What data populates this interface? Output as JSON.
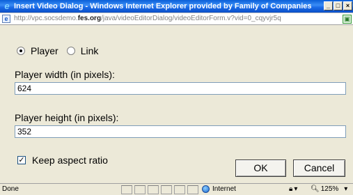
{
  "window": {
    "title": "Insert Video Dialog - Windows Internet Explorer provided by Family of Companies",
    "buttons": {
      "minimize": "_",
      "maximize": "□",
      "close": "×"
    }
  },
  "address": {
    "url_prefix": "http://vpc.socsdemo.",
    "url_domain": "fes.org",
    "url_suffix": "/java/videoEditorDialog/videoEditorForm.v?vid=0_cqyvjr5q"
  },
  "form": {
    "options": [
      {
        "label": "Player",
        "checked": true
      },
      {
        "label": "Link",
        "checked": false
      }
    ],
    "width_label": "Player width (in pixels):",
    "width_value": "624",
    "height_label": "Player height (in pixels):",
    "height_value": "352",
    "aspect_label": "Keep aspect ratio",
    "aspect_checked": true,
    "ok_label": "OK",
    "cancel_label": "Cancel"
  },
  "status": {
    "text": "Done",
    "zone": "Internet",
    "zoom": "125%"
  },
  "icons": {
    "browser": "ie-logo-icon",
    "page": "page-icon",
    "compat": "compatibility-icon",
    "zone": "globe-icon",
    "protected": "protected-mode-icon",
    "zoom": "zoom-icon"
  }
}
